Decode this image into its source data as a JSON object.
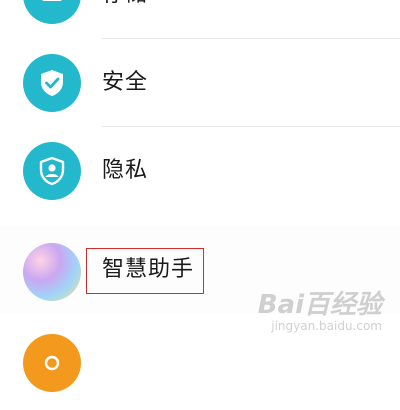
{
  "settings_list": {
    "items": [
      {
        "label": "存储",
        "icon": "storage-icon",
        "color": "#23b8cc"
      },
      {
        "label": "安全",
        "icon": "shield-check-icon",
        "color": "#23b8cc"
      },
      {
        "label": "隐私",
        "icon": "privacy-shield-user-icon",
        "color": "#23b8cc"
      },
      {
        "label": "智慧助手",
        "icon": "smart-assistant-icon",
        "color": "#9b7fe0"
      },
      {
        "label": "",
        "icon": "orange-app-icon",
        "color": "#f39a1e"
      }
    ],
    "highlight_color": "#d42b2b"
  },
  "watermark": {
    "main": "Bai百经验",
    "sub": "jingyan.baidu.com"
  }
}
